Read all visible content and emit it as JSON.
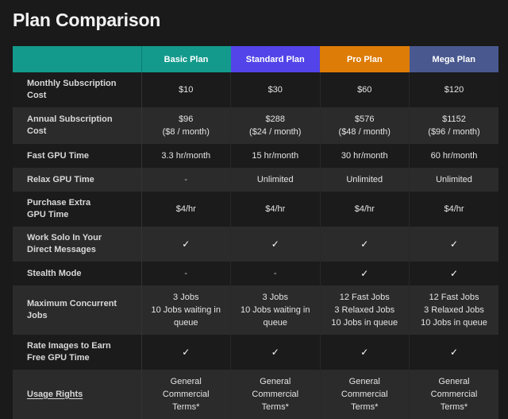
{
  "page": {
    "title": "Plan Comparison",
    "background_color": "#1a1a1a"
  },
  "table": {
    "header": {
      "label_column": "",
      "plans": [
        {
          "name": "Basic Plan",
          "color": "#139a8c"
        },
        {
          "name": "Standard Plan",
          "color": "#5244e8"
        },
        {
          "name": "Pro Plan",
          "color": "#dd7c06"
        },
        {
          "name": "Mega Plan",
          "color": "#49598f"
        }
      ]
    },
    "rows": [
      {
        "label": "Monthly Subscription Cost",
        "label_lines": [
          "Monthly Subscription",
          "Cost"
        ],
        "is_link": false,
        "cells": [
          {
            "lines": [
              "$10"
            ]
          },
          {
            "lines": [
              "$30"
            ]
          },
          {
            "lines": [
              "$60"
            ]
          },
          {
            "lines": [
              "$120"
            ]
          }
        ]
      },
      {
        "label": "Annual Subscription Cost",
        "label_lines": [
          "Annual Subscription",
          "Cost"
        ],
        "is_link": false,
        "cells": [
          {
            "lines": [
              "$96",
              "($8 / month)"
            ]
          },
          {
            "lines": [
              "$288",
              "($24 / month)"
            ]
          },
          {
            "lines": [
              "$576",
              "($48 / month)"
            ]
          },
          {
            "lines": [
              "$1152",
              "($96 / month)"
            ]
          }
        ]
      },
      {
        "label": "Fast GPU Time",
        "label_lines": [
          "Fast GPU Time"
        ],
        "is_link": false,
        "cells": [
          {
            "lines": [
              "3.3 hr/month"
            ]
          },
          {
            "lines": [
              "15 hr/month"
            ]
          },
          {
            "lines": [
              "30 hr/month"
            ]
          },
          {
            "lines": [
              "60 hr/month"
            ]
          }
        ]
      },
      {
        "label": "Relax GPU Time",
        "label_lines": [
          "Relax GPU Time"
        ],
        "is_link": false,
        "cells": [
          {
            "lines": [
              "-"
            ]
          },
          {
            "lines": [
              "Unlimited"
            ]
          },
          {
            "lines": [
              "Unlimited"
            ]
          },
          {
            "lines": [
              "Unlimited"
            ]
          }
        ]
      },
      {
        "label": "Purchase Extra GPU Time",
        "label_lines": [
          "Purchase Extra",
          "GPU Time"
        ],
        "is_link": false,
        "cells": [
          {
            "lines": [
              "$4/hr"
            ]
          },
          {
            "lines": [
              "$4/hr"
            ]
          },
          {
            "lines": [
              "$4/hr"
            ]
          },
          {
            "lines": [
              "$4/hr"
            ]
          }
        ]
      },
      {
        "label": "Work Solo In Your Direct Messages",
        "label_lines": [
          "Work Solo In Your",
          "Direct Messages"
        ],
        "is_link": false,
        "cells": [
          {
            "lines": [
              "✓"
            ]
          },
          {
            "lines": [
              "✓"
            ]
          },
          {
            "lines": [
              "✓"
            ]
          },
          {
            "lines": [
              "✓"
            ]
          }
        ]
      },
      {
        "label": "Stealth Mode",
        "label_lines": [
          "Stealth Mode"
        ],
        "is_link": false,
        "cells": [
          {
            "lines": [
              "-"
            ]
          },
          {
            "lines": [
              "-"
            ]
          },
          {
            "lines": [
              "✓"
            ]
          },
          {
            "lines": [
              "✓"
            ]
          }
        ]
      },
      {
        "label": "Maximum Concurrent Jobs",
        "label_lines": [
          "Maximum Concurrent",
          "Jobs"
        ],
        "is_link": false,
        "cells": [
          {
            "lines": [
              "3 Jobs",
              "10 Jobs waiting in queue"
            ]
          },
          {
            "lines": [
              "3 Jobs",
              "10 Jobs waiting in queue"
            ]
          },
          {
            "lines": [
              "12 Fast Jobs",
              "3 Relaxed Jobs",
              "10 Jobs in queue"
            ]
          },
          {
            "lines": [
              "12 Fast Jobs",
              "3 Relaxed Jobs",
              "10 Jobs in queue"
            ]
          }
        ]
      },
      {
        "label": "Rate Images to Earn Free GPU Time",
        "label_lines": [
          "Rate Images to Earn",
          "Free GPU Time"
        ],
        "is_link": false,
        "cells": [
          {
            "lines": [
              "✓"
            ]
          },
          {
            "lines": [
              "✓"
            ]
          },
          {
            "lines": [
              "✓"
            ]
          },
          {
            "lines": [
              "✓"
            ]
          }
        ]
      },
      {
        "label": "Usage Rights",
        "label_lines": [
          "Usage Rights"
        ],
        "is_link": true,
        "cells": [
          {
            "lines": [
              "General",
              "Commercial",
              "Terms*"
            ]
          },
          {
            "lines": [
              "General",
              "Commercial",
              "Terms*"
            ]
          },
          {
            "lines": [
              "General",
              "Commercial",
              "Terms*"
            ]
          },
          {
            "lines": [
              "General",
              "Commercial",
              "Terms*"
            ]
          }
        ]
      }
    ]
  }
}
